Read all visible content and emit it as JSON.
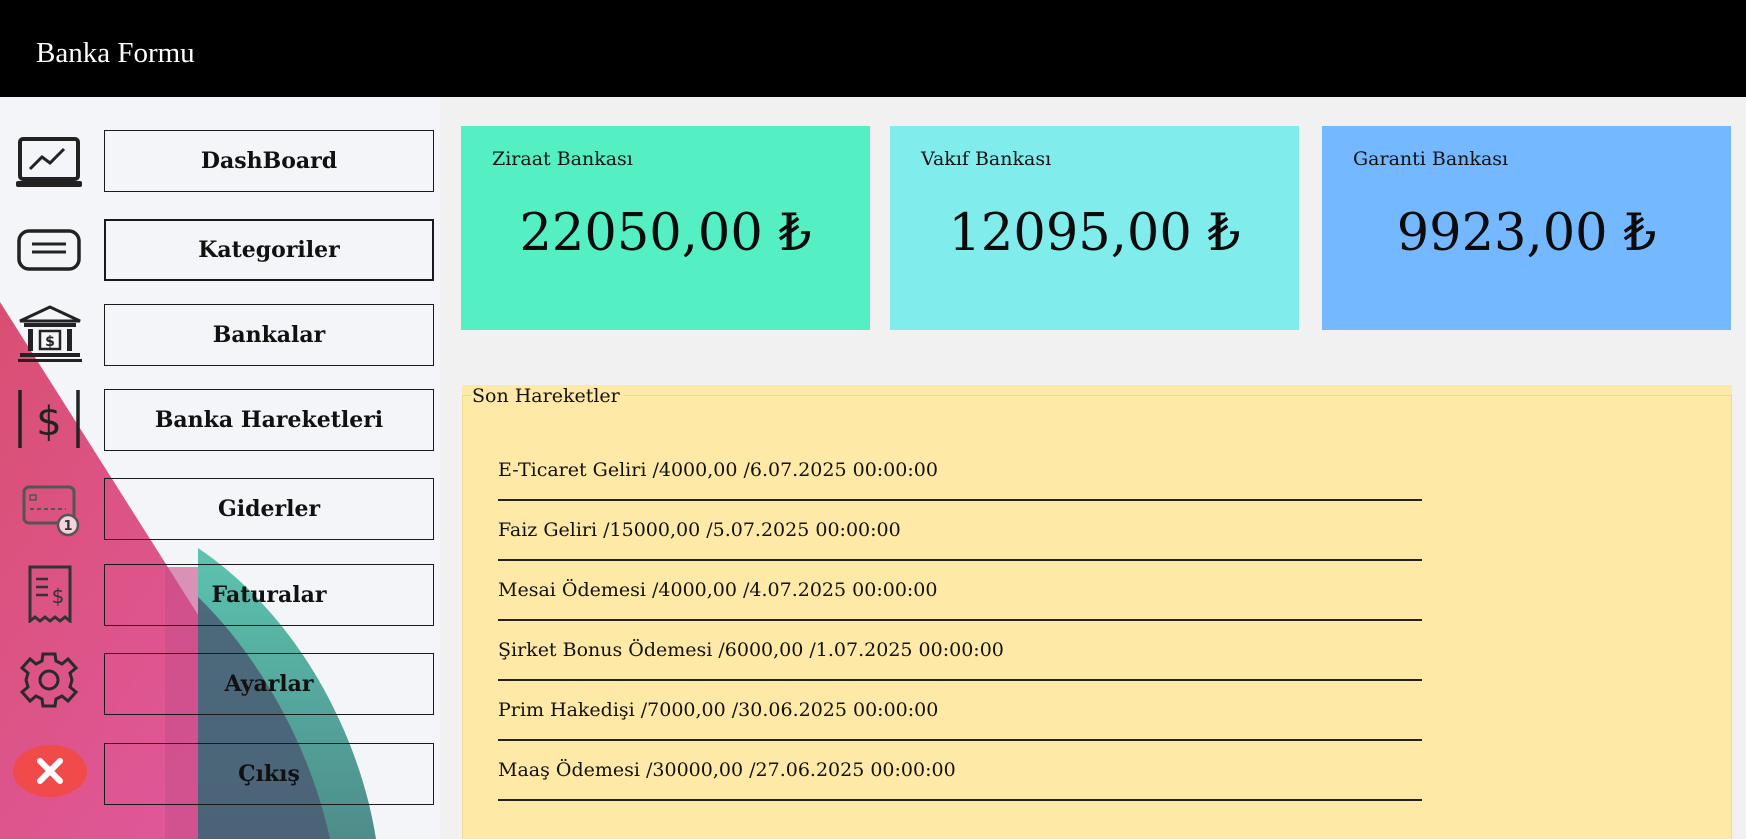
{
  "window": {
    "title": "Banka Formu"
  },
  "sidebar": {
    "items": [
      {
        "label": "DashBoard",
        "icon": "chart-monitor-icon"
      },
      {
        "label": "Kategoriler",
        "icon": "message-lines-icon"
      },
      {
        "label": "Bankalar",
        "icon": "bank-building-icon"
      },
      {
        "label": "Banka Hareketleri",
        "icon": "dollar-box-icon"
      },
      {
        "label": "Giderler",
        "icon": "card-payment-icon"
      },
      {
        "label": "Faturalar",
        "icon": "receipt-icon"
      },
      {
        "label": "Ayarlar",
        "icon": "gear-icon"
      },
      {
        "label": "Çıkış",
        "icon": "close-circle-icon"
      }
    ]
  },
  "cards": [
    {
      "name": "Ziraat Bankası",
      "amount": "22050,00 ₺",
      "color": "#55efc4"
    },
    {
      "name": "Vakıf Bankası",
      "amount": "12095,00 ₺",
      "color": "#81ecec"
    },
    {
      "name": "Garanti Bankası",
      "amount": "9923,00 ₺",
      "color": "#74b9ff"
    }
  ],
  "recent": {
    "title": "Son Hareketler",
    "items": [
      "E-Ticaret Geliri /4000,00 /6.07.2025 00:00:00",
      "Faiz Geliri /15000,00 /5.07.2025 00:00:00",
      "Mesai Ödemesi /4000,00 /4.07.2025 00:00:00",
      "Şirket Bonus Ödemesi /6000,00 /1.07.2025 00:00:00",
      "Prim Hakedişi /7000,00 /30.06.2025 00:00:00",
      "Maaş Ödemesi /30000,00 /27.06.2025 00:00:00"
    ]
  },
  "colors": {
    "titlebar": "#000000",
    "panel_bg": "#ffe9a6",
    "sidebar_pink": "#e1507e",
    "sidebar_teal": "#5ab4a6"
  }
}
